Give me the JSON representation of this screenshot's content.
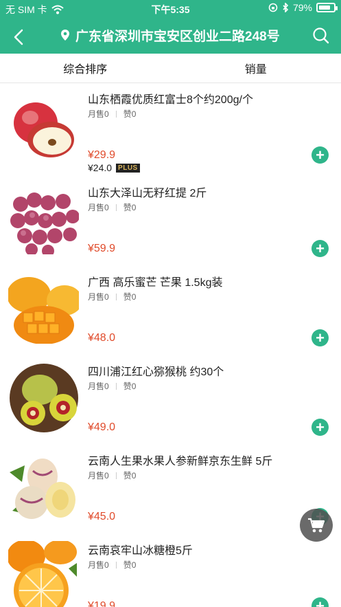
{
  "colors": {
    "brand": "#2fb58a",
    "price": "#e04b2b"
  },
  "status_bar": {
    "carrier": "无 SIM 卡",
    "wifi_icon": "wifi-icon",
    "time": "下午5:35",
    "battery": "79%",
    "battery_fill": 0.79
  },
  "navbar": {
    "back_icon": "back-chevron-icon",
    "location_icon": "location-pin-icon",
    "address": "广东省深圳市宝安区创业二路248号",
    "search_icon": "search-icon"
  },
  "tabs": [
    {
      "label": "综合排序"
    },
    {
      "label": "销量"
    }
  ],
  "products": [
    {
      "title": "山东栖霞优质红富士8个约200g/个",
      "sales": "月售0",
      "likes": "赞0",
      "price": "¥29.9",
      "plus_price": "¥24.0",
      "plus_badge": "PLUS"
    },
    {
      "title": "山东大泽山无籽红提 2斤",
      "sales": "月售0",
      "likes": "赞0",
      "price": "¥59.9"
    },
    {
      "title": "广西 高乐蜜芒 芒果 1.5kg装",
      "sales": "月售0",
      "likes": "赞0",
      "price": "¥48.0"
    },
    {
      "title": "四川浦江红心猕猴桃 约30个",
      "sales": "月售0",
      "likes": "赞0",
      "price": "¥49.0"
    },
    {
      "title": "云南人生果水果人参新鲜京东生鲜 5斤",
      "sales": "月售0",
      "likes": "赞0",
      "price": "¥45.0"
    },
    {
      "title": "云南哀牢山冰糖橙5斤",
      "sales": "月售0",
      "likes": "赞0",
      "price": "¥19.9"
    }
  ],
  "add_button_label": "+",
  "cart_icon": "cart-icon"
}
